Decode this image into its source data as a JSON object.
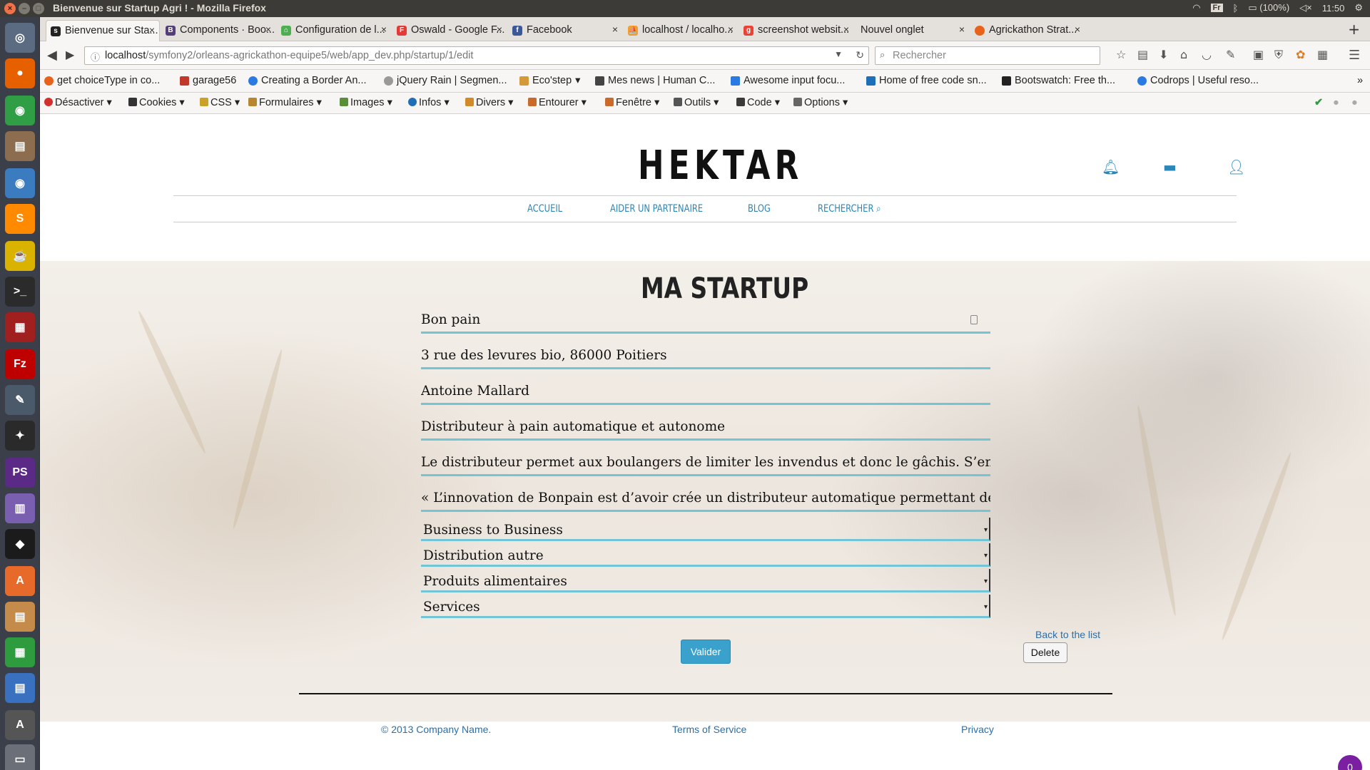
{
  "os": {
    "window_title": "Bienvenue sur Startup Agri ! - Mozilla Firefox",
    "keyboard": "Fr",
    "battery": "(100%)",
    "clock": "11:50"
  },
  "tabs": [
    {
      "label": "Bienvenue sur Sta...",
      "icon": "symfony-icon",
      "color": "#222222"
    },
    {
      "label": "Components · Boo...",
      "icon": "bootstrap-icon",
      "color": "#563d7c"
    },
    {
      "label": "Configuration de l...",
      "icon": "page-icon",
      "color": "#4caf50"
    },
    {
      "label": "Oswald - Google F...",
      "icon": "google-fonts-icon",
      "color": "#e53935"
    },
    {
      "label": "Facebook",
      "icon": "facebook-icon",
      "color": "#3b5998"
    },
    {
      "label": "localhost / localho...",
      "icon": "phpmyadmin-icon",
      "color": "#f0a030"
    },
    {
      "label": "screenshot websit...",
      "icon": "google-icon",
      "color": "#ea4335"
    },
    {
      "label": "Nouvel onglet",
      "icon": "none",
      "color": "#e4e1dc"
    },
    {
      "label": "Agrickathon Strat...",
      "icon": "loading-icon",
      "color": "#e8621c"
    }
  ],
  "url": {
    "host": "localhost",
    "path": "/symfony2/orleans-agrickathon-equipe5/web/app_dev.php/startup/1/edit"
  },
  "search": {
    "placeholder": "Rechercher"
  },
  "bookmarks": [
    "get choiceType in co...",
    "garage56",
    "Creating a Border An...",
    "jQuery Rain | Segmen...",
    "Eco'step",
    "Mes news | Human C...",
    "Awesome input focu...",
    "Home of free code sn...",
    "Bootswatch: Free th...",
    "Codrops | Useful reso..."
  ],
  "devbar": [
    "Désactiver",
    "Cookies",
    "CSS",
    "Formulaires",
    "Images",
    "Infos",
    "Divers",
    "Entourer",
    "Fenêtre",
    "Outils",
    "Code",
    "Options"
  ],
  "site": {
    "logo": "HEKTAR",
    "menu": [
      "ACCUEIL",
      "AIDER UN PARTENAIRE",
      "BLOG",
      "RECHERCHER"
    ],
    "page_title": "MA STARTUP",
    "fields": [
      "Bon pain",
      "3 rue des levures bio, 86000 Poitiers",
      "Antoine Mallard",
      "Distributeur à pain automatique et autonome",
      "Le distributeur permet aux boulangers de limiter les invendus et donc le gâchis. S’en remetta",
      "« L’innovation de Bonpain est d’avoir crée un distributeur automatique permettant de fourni"
    ],
    "selects": [
      "Business to Business",
      "Distribution autre",
      "Produits alimentaires",
      "Services"
    ],
    "submit": "Valider",
    "back_link": "Back to the list",
    "delete": "Delete",
    "footer": {
      "copyright": "© 2013 Company Name.",
      "terms": "Terms of Service",
      "privacy": "Privacy"
    },
    "notification_count": "0"
  }
}
